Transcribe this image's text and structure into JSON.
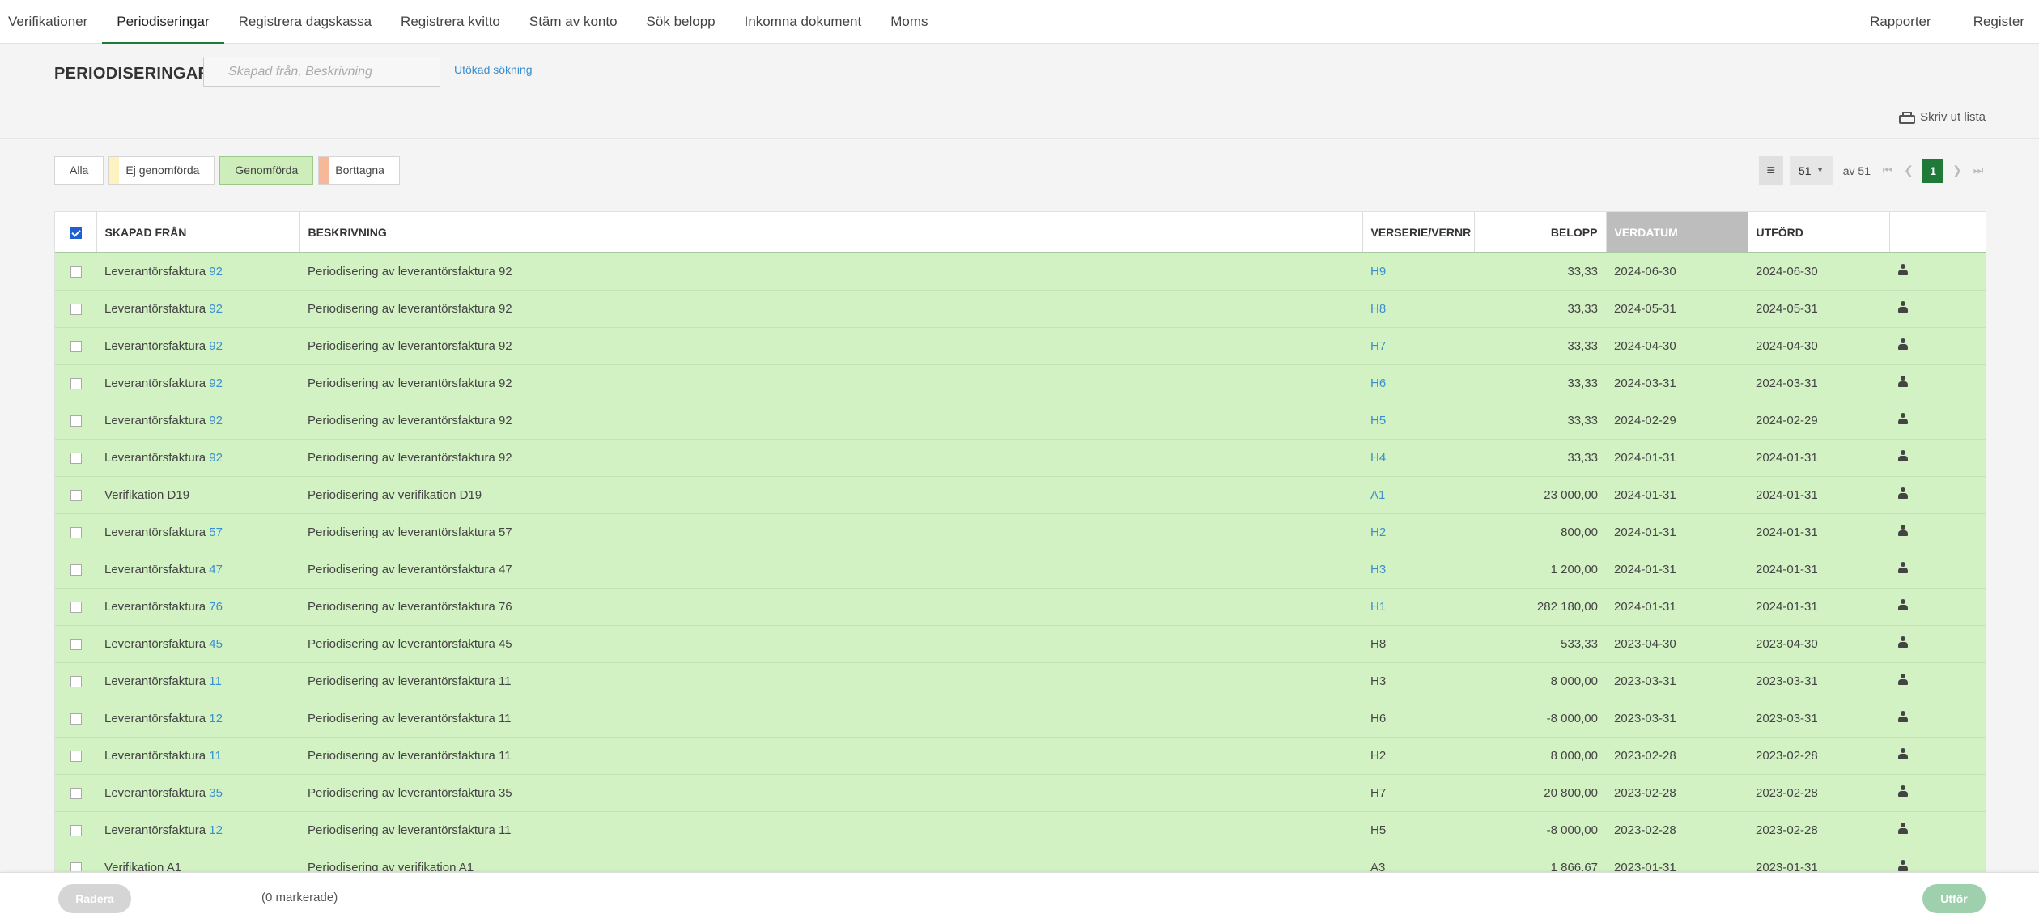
{
  "nav": {
    "left": [
      "Verifikationer",
      "Periodiseringar",
      "Registrera dagskassa",
      "Registrera kvitto",
      "Stäm av konto",
      "Sök belopp",
      "Inkomna dokument",
      "Moms"
    ],
    "active_index": 1,
    "right": [
      "Rapporter",
      "Register"
    ]
  },
  "header": {
    "title": "PERIODISERINGAR",
    "search_placeholder": "Skapad från, Beskrivning",
    "advanced_search": "Utökad sökning",
    "print": "Skriv ut lista"
  },
  "filters": [
    {
      "label": "Alla",
      "swatch": "",
      "active": false
    },
    {
      "label": "Ej genomförda",
      "swatch": "#fdf3c0",
      "active": false
    },
    {
      "label": "Genomförda",
      "swatch": "",
      "active": true
    },
    {
      "label": "Borttagna",
      "swatch": "#f6b899",
      "active": false
    }
  ],
  "pager": {
    "per_page": "51",
    "of_text": "av 51",
    "current": "1"
  },
  "columns": {
    "created_from": "SKAPAD FRÅN",
    "description": "BESKRIVNING",
    "series": "VERSERIE/VERNR",
    "amount": "BELOPP",
    "verdate": "VERDATUM",
    "done": "UTFÖRD"
  },
  "rows": [
    {
      "from": "Leverantörsfaktura",
      "from_link": "92",
      "desc": "Periodisering av leverantörsfaktura 92",
      "series": "H9",
      "series_link": true,
      "amount": "33,33",
      "verdate": "2024-06-30",
      "done": "2024-06-30"
    },
    {
      "from": "Leverantörsfaktura",
      "from_link": "92",
      "desc": "Periodisering av leverantörsfaktura 92",
      "series": "H8",
      "series_link": true,
      "amount": "33,33",
      "verdate": "2024-05-31",
      "done": "2024-05-31"
    },
    {
      "from": "Leverantörsfaktura",
      "from_link": "92",
      "desc": "Periodisering av leverantörsfaktura 92",
      "series": "H7",
      "series_link": true,
      "amount": "33,33",
      "verdate": "2024-04-30",
      "done": "2024-04-30"
    },
    {
      "from": "Leverantörsfaktura",
      "from_link": "92",
      "desc": "Periodisering av leverantörsfaktura 92",
      "series": "H6",
      "series_link": true,
      "amount": "33,33",
      "verdate": "2024-03-31",
      "done": "2024-03-31"
    },
    {
      "from": "Leverantörsfaktura",
      "from_link": "92",
      "desc": "Periodisering av leverantörsfaktura 92",
      "series": "H5",
      "series_link": true,
      "amount": "33,33",
      "verdate": "2024-02-29",
      "done": "2024-02-29"
    },
    {
      "from": "Leverantörsfaktura",
      "from_link": "92",
      "desc": "Periodisering av leverantörsfaktura 92",
      "series": "H4",
      "series_link": true,
      "amount": "33,33",
      "verdate": "2024-01-31",
      "done": "2024-01-31"
    },
    {
      "from": "Verifikation D19",
      "from_link": "",
      "desc": "Periodisering av verifikation D19",
      "series": "A1",
      "series_link": true,
      "amount": "23 000,00",
      "verdate": "2024-01-31",
      "done": "2024-01-31"
    },
    {
      "from": "Leverantörsfaktura",
      "from_link": "57",
      "desc": "Periodisering av leverantörsfaktura 57",
      "series": "H2",
      "series_link": true,
      "amount": "800,00",
      "verdate": "2024-01-31",
      "done": "2024-01-31"
    },
    {
      "from": "Leverantörsfaktura",
      "from_link": "47",
      "desc": "Periodisering av leverantörsfaktura 47",
      "series": "H3",
      "series_link": true,
      "amount": "1 200,00",
      "verdate": "2024-01-31",
      "done": "2024-01-31"
    },
    {
      "from": "Leverantörsfaktura",
      "from_link": "76",
      "desc": "Periodisering av leverantörsfaktura 76",
      "series": "H1",
      "series_link": true,
      "amount": "282 180,00",
      "verdate": "2024-01-31",
      "done": "2024-01-31"
    },
    {
      "from": "Leverantörsfaktura",
      "from_link": "45",
      "desc": "Periodisering av leverantörsfaktura 45",
      "series": "H8",
      "series_link": false,
      "amount": "533,33",
      "verdate": "2023-04-30",
      "done": "2023-04-30"
    },
    {
      "from": "Leverantörsfaktura",
      "from_link": "11",
      "desc": "Periodisering av leverantörsfaktura 11",
      "series": "H3",
      "series_link": false,
      "amount": "8 000,00",
      "verdate": "2023-03-31",
      "done": "2023-03-31"
    },
    {
      "from": "Leverantörsfaktura",
      "from_link": "12",
      "desc": "Periodisering av leverantörsfaktura 11",
      "series": "H6",
      "series_link": false,
      "amount": "-8 000,00",
      "verdate": "2023-03-31",
      "done": "2023-03-31"
    },
    {
      "from": "Leverantörsfaktura",
      "from_link": "11",
      "desc": "Periodisering av leverantörsfaktura 11",
      "series": "H2",
      "series_link": false,
      "amount": "8 000,00",
      "verdate": "2023-02-28",
      "done": "2023-02-28"
    },
    {
      "from": "Leverantörsfaktura",
      "from_link": "35",
      "desc": "Periodisering av leverantörsfaktura 35",
      "series": "H7",
      "series_link": false,
      "amount": "20 800,00",
      "verdate": "2023-02-28",
      "done": "2023-02-28"
    },
    {
      "from": "Leverantörsfaktura",
      "from_link": "12",
      "desc": "Periodisering av leverantörsfaktura 11",
      "series": "H5",
      "series_link": false,
      "amount": "-8 000,00",
      "verdate": "2023-02-28",
      "done": "2023-02-28"
    },
    {
      "from": "Verifikation A1",
      "from_link": "",
      "desc": "Periodisering av verifikation A1",
      "series": "A3",
      "series_link": false,
      "amount": "1 866,67",
      "verdate": "2023-01-31",
      "done": "2023-01-31"
    }
  ],
  "bottom": {
    "delete": "Radera",
    "marked": "(0 markerade)",
    "execute": "Utför"
  },
  "colors": {
    "brand_green": "#1f7a3a",
    "row_green": "#d3f2c4",
    "link_blue": "#3a8fd1"
  },
  "icons": {
    "print": "printer-icon",
    "list": "list-icon",
    "row_action": "user-icon"
  }
}
